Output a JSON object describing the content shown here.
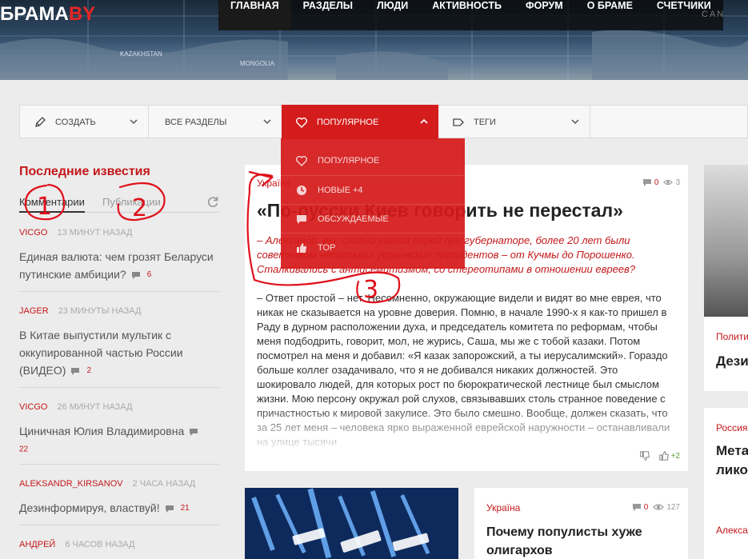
{
  "brand": {
    "logo_main": "БРАМА",
    "logo_accent": "BY"
  },
  "topnav": {
    "items": [
      {
        "label": "ГЛАВНАЯ"
      },
      {
        "label": "РАЗДЕЛЫ"
      },
      {
        "label": "ЛЮДИ"
      },
      {
        "label": "АКТИВНОСТЬ"
      },
      {
        "label": "ФОРУМ"
      },
      {
        "label": "О БРАМЕ"
      },
      {
        "label": "СЧЕТЧИКИ"
      }
    ],
    "corner_text": "CAN"
  },
  "header_map_labels": [
    "KAZAKHSTAN",
    "MONGOLIA"
  ],
  "toolbar": {
    "create": "СОЗДАТЬ",
    "sections": "ВСЕ РАЗДЕЛЫ",
    "popular": "ПОПУЛЯРНОЕ",
    "tags": "ТЕГИ"
  },
  "dropdown": {
    "items": [
      {
        "label": "ПОПУЛЯРНОЕ",
        "icon": "heart-icon"
      },
      {
        "label": "НОВЫЕ +4",
        "icon": "clock-icon"
      },
      {
        "label": "ОБСУЖДАЕМЫЕ",
        "icon": "comment-icon"
      },
      {
        "label": "TOP",
        "icon": "thumbs-up-icon"
      }
    ]
  },
  "left": {
    "title": "Последние известия",
    "tab_comments": "Комментарии",
    "tab_publications": "Публикации",
    "items": [
      {
        "author": "VICGO",
        "time": "13 МИНУТ НАЗАД",
        "title": "Единая валюта: чем грозят Беларуси путинские амбиции?",
        "count": "6"
      },
      {
        "author": "JAGER",
        "time": "23 МИНУТЫ НАЗАД",
        "title": "В Китае выпустили мультик с оккупированной частью России (ВИДЕО)",
        "count": "2"
      },
      {
        "author": "VICGO",
        "time": "26 МИНУТ НАЗАД",
        "title": "Циничная Юлия Владимировна",
        "count": "22"
      },
      {
        "author": "ALEKSANDR_KIRSANOV",
        "time": "2 ЧАСА НАЗАД",
        "title": "Дезинформируя, властвуй!",
        "count": "21"
      },
      {
        "author": "АНДРЕЙ",
        "time": "6 ЧАСОВ НАЗАД",
        "title": "",
        "count": ""
      }
    ]
  },
  "main_card": {
    "category": "Україна",
    "comments": "0",
    "views": "3",
    "title": "«По-русски Киев говорить не перестал»",
    "lead": "– Александр, вы, словно умный еврей при губернаторе, более 20 лет были советником нескольких украинских президентов – от Кучмы до Порошенко. Сталкивались с антисемитизмом, со стереотипами в отношении евреев?",
    "body": "– Ответ простой – нет. Несомненно, окружающие видели и видят во мне еврея, что никак не сказывается на уровне доверия. Помню, в начале 1990-х я как-то пришел в Раду в дурном расположении духа, и председатель комитета по реформам, чтобы меня подбодрить, говорит, мол, не журись, Саша, мы же с тобой казаки. Потом посмотрел на меня и добавил: «Я казак запорожский, а ты иерусалимский». Гораздо больше коллег озадачивало, что я не добивался никаких должностей. Это шокировало людей, для которых рост по бюрократической лестнице был смыслом жизни. Мою персону окружал рой слухов, связывавших столь странное поведение с причастностью к мировой закулисе. Это было смешно. Вообще, должен сказать, что за 25 лет меня – человека ярко выраженной еврейской наружности – останавливали на улице тысячи",
    "votes": "+2"
  },
  "card2": {
    "category": "Україна",
    "comments": "0",
    "views": "127",
    "title": "Почему популисты хуже олигархов"
  },
  "right_card1": {
    "category": "Полити",
    "title": "Дези"
  },
  "right_card2": {
    "category": "Россия",
    "title": "Мета иллю лико озлоб",
    "author": "Алекса"
  },
  "annotations": {
    "n1": "1",
    "n2": "2",
    "n3": "3"
  },
  "colors": {
    "brand_red": "#c4171a",
    "active_red": "#d41c1c"
  }
}
